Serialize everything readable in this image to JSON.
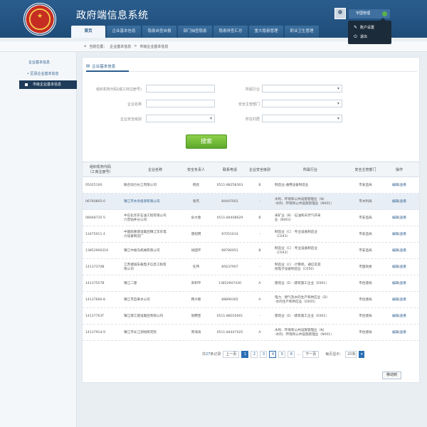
{
  "app": {
    "title": "政府端信息系统"
  },
  "nav": [
    {
      "label": "首页"
    },
    {
      "label": "企业基本信息"
    },
    {
      "label": "隐患自查自报"
    },
    {
      "label": "部门抽查隐患"
    },
    {
      "label": "隐患排查汇总"
    },
    {
      "label": "重大隐患管理"
    },
    {
      "label": "职业卫生管理"
    }
  ],
  "user": {
    "name": "宇国管理",
    "menu": [
      {
        "label": "账户设置",
        "icon": "wrench-icon"
      },
      {
        "label": "退出",
        "icon": "power-icon"
      }
    ]
  },
  "breadcrumb": {
    "prefix": "当前位置：",
    "items": [
      "企业基本信息",
      "市级企业基本信息"
    ],
    "sep": ">"
  },
  "sidebar": {
    "heading": "企业基本信息",
    "items": [
      {
        "label": "区县企业基本信息"
      },
      {
        "label": "市级企业基本信息"
      }
    ]
  },
  "panel": {
    "title": "企业基本信息"
  },
  "filters": {
    "org_code": {
      "label": "组织机构代码(或工商注册号)",
      "value": ""
    },
    "industry": {
      "label": "所属行业",
      "value": ""
    },
    "company_name": {
      "label": "企业名称",
      "value": ""
    },
    "dept": {
      "label": "安全主管部门",
      "value": ""
    },
    "safety_level": {
      "label": "企业安全级别",
      "value": ""
    },
    "location": {
      "label": "所在村居",
      "value": ""
    },
    "search_label": "搜索"
  },
  "table": {
    "columns": [
      "组织机构代码\n（工商注册号）",
      "企业名称",
      "安全负责人",
      "联系电话",
      "企业安全级别",
      "所属行业",
      "安全主管部门",
      "操作"
    ],
    "rows": [
      {
        "code": "05025100",
        "name": "联合动力长江有限公司",
        "person": "杨虎",
        "phone": "0511-88258303",
        "level": "B",
        "industry": "制造业-通用设备制造业",
        "dept": "市安监局",
        "ops": "编辑|查看"
      },
      {
        "code": "06760805-0",
        "name": "镇江市水务投资有限公司",
        "person": "张杰",
        "phone": "84447001",
        "level": "-",
        "industry": "水利、环境和公共设施管理业（N）\n-水利、环境和公共设施管理业（N001）",
        "dept": "市水利局",
        "ops": "编辑|查看"
      },
      {
        "code": "08948735-5",
        "name": "中石化华东石油工程有限公司\n六普钻井分公司",
        "person": "俞大春",
        "phone": "0511-84408629",
        "level": "B",
        "industry": "采矿业（B）-石油和天然气开采\n业（B003）",
        "dept": "市安监局",
        "ops": "编辑|查看"
      },
      {
        "code": "13475011 4",
        "name": "中国船重建设集团镇江华东电\n力设备制造厂",
        "person": "唐绍明",
        "phone": "87051633",
        "level": "-",
        "industry": "制造业（C）-专业设备制造业\n（C043）",
        "dept": "市安监局",
        "ops": "编辑|查看"
      },
      {
        "code": "13852900316",
        "name": "镇江中福马机械有限公司",
        "person": "徐国平",
        "phone": "88780051",
        "level": "B",
        "industry": "制造业（C）-专业设备制造业\n（C043）",
        "dept": "市安监局",
        "ops": "编辑|查看"
      },
      {
        "code": "14137370B",
        "name": "江苏捷诚车载电子信息工程有\n限公司",
        "person": "任伟",
        "phone": "85637907",
        "level": "-",
        "industry": "制造业（C）-计算机、通信及其\n他电子设备制造业（C050）",
        "dept": "市国资委",
        "ops": "编辑|查看"
      },
      {
        "code": "14137557B",
        "name": "镇江二建",
        "person": "宋和平",
        "phone": "13852907430",
        "level": "A",
        "industry": "建筑业（E）-建筑施工企业（E001）",
        "dept": "市住建局",
        "ops": "编辑|查看"
      },
      {
        "code": "14137666-8",
        "name": "镇江市自来水公司",
        "person": "韩兴春",
        "phone": "88890365",
        "level": "A",
        "industry": "电力、燃气及水的生产和供应业（D）\n-水的生产和供应业（D005）",
        "dept": "市住建局",
        "ops": "编辑|查看"
      },
      {
        "code": "14137763T",
        "name": "镇江建工建设集团有限公司",
        "person": "张腾宝",
        "phone": "0511-88010001",
        "level": "-",
        "industry": "建筑业（E）-建筑施工企业（E001）",
        "dept": "市住建局",
        "ops": "编辑|查看"
      },
      {
        "code": "14137914-9",
        "name": "镇江市长江测绘研究院",
        "person": "周海涛",
        "phone": "0511-84447025",
        "level": "A",
        "industry": "水利、环境和公共设施管理业（N）\n-水利、环境和公共设施管理业（N001）",
        "dept": "市住建局",
        "ops": "编辑|查看"
      }
    ]
  },
  "pager": {
    "total_prefix": "共",
    "total": "27",
    "total_suffix": "条记录",
    "prev": "上一页",
    "next": "下一页",
    "pages": [
      "1",
      "2",
      "3",
      "4",
      "5",
      "6"
    ],
    "current_page": "1",
    "ellipsis": "...",
    "per_page_label": "每页显示：",
    "per_page": "20条"
  },
  "actions": {
    "move": "移动到"
  },
  "colors": {
    "header": "#1f4c78",
    "accent": "#2a5d8e",
    "search": "#6db535",
    "selected_row": "#e8eef5"
  }
}
